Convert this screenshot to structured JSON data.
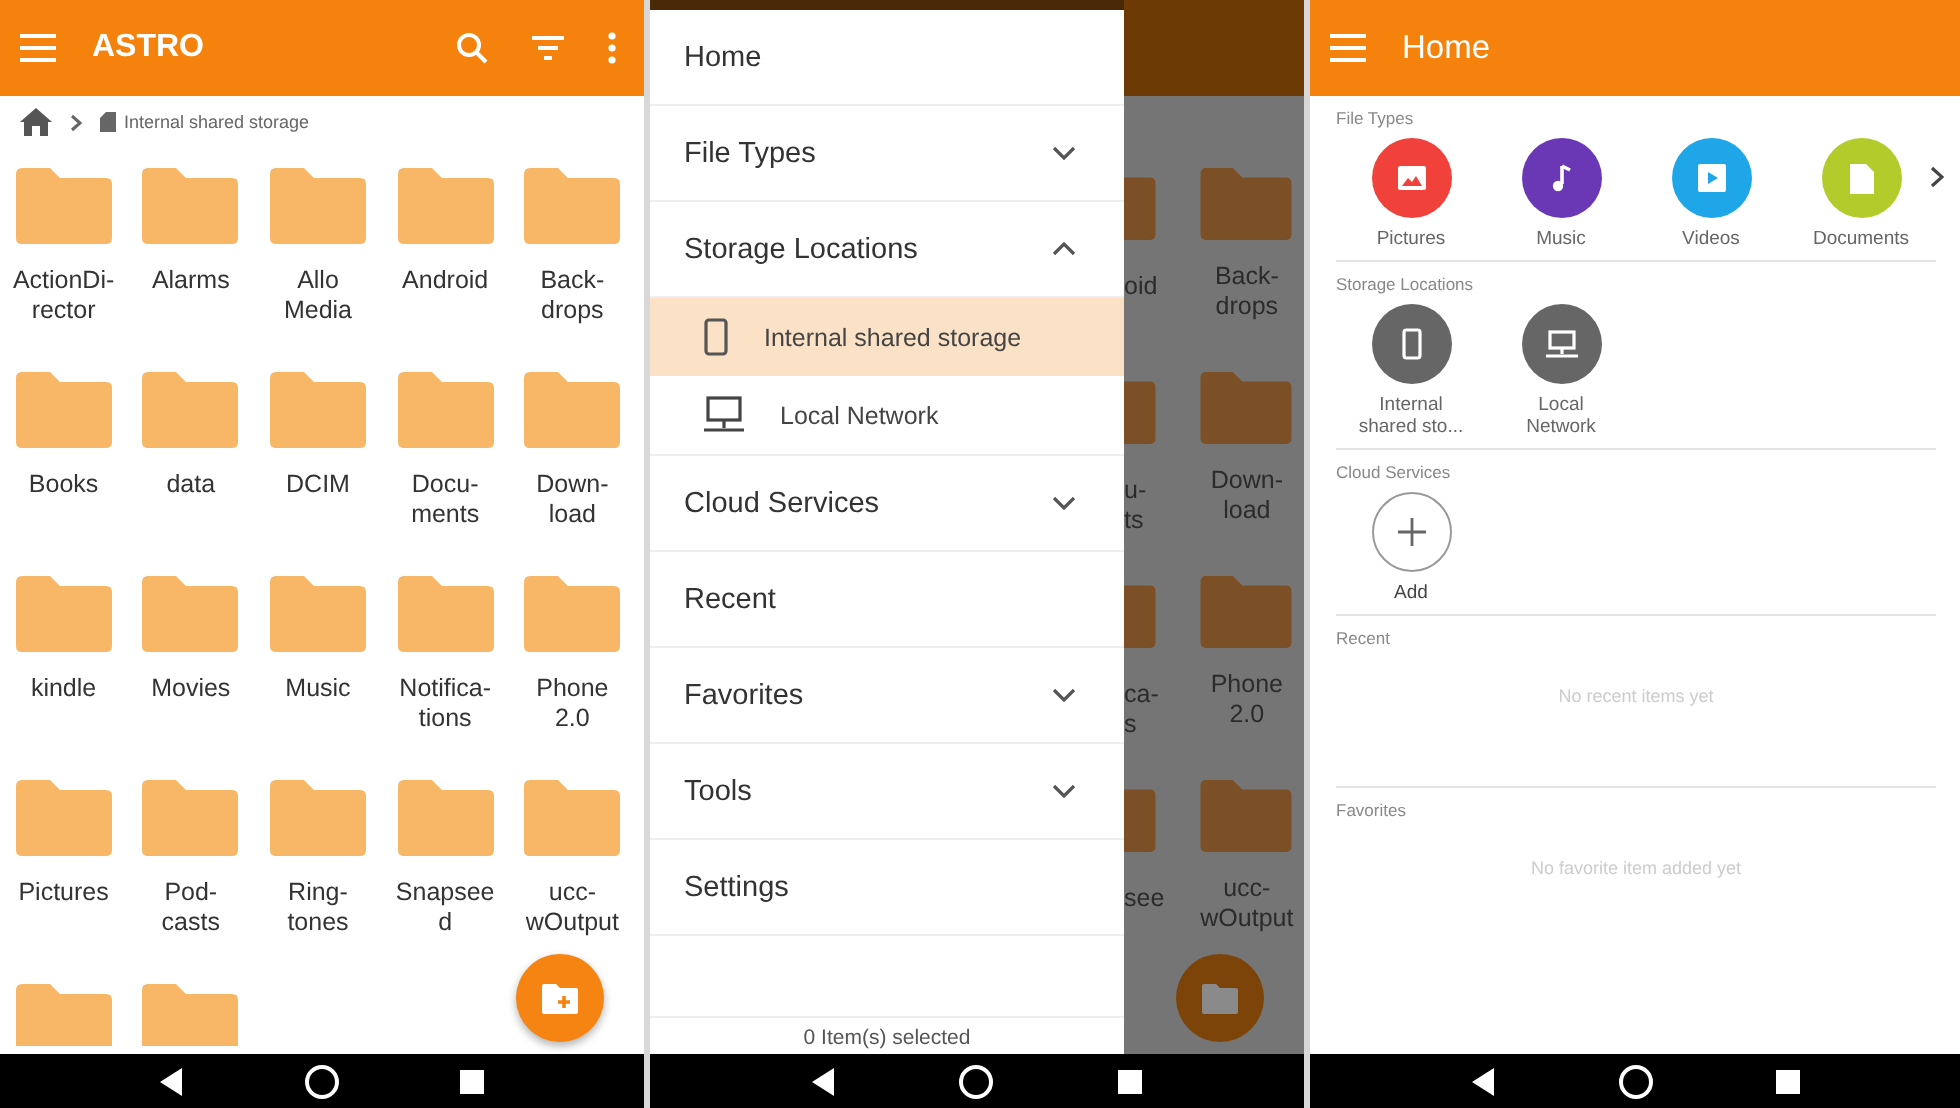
{
  "browser_screen": {
    "title": "ASTRO",
    "breadcrumb": "Internal shared storage",
    "folders": [
      {
        "label": "ActionDi-\nrector",
        "cut_off": false
      },
      {
        "label": "Alarms",
        "cut_off": false
      },
      {
        "label": "Allo\nMedia",
        "cut_off": false
      },
      {
        "label": "Android",
        "cut_off": false
      },
      {
        "label": "Back-\ndrops",
        "cut_off": false
      },
      {
        "label": "Books",
        "cut_off": false
      },
      {
        "label": "data",
        "cut_off": false
      },
      {
        "label": "DCIM",
        "cut_off": false
      },
      {
        "label": "Docu-\nments",
        "cut_off": false
      },
      {
        "label": "Down-\nload",
        "cut_off": false
      },
      {
        "label": "kindle",
        "cut_off": false
      },
      {
        "label": "Movies",
        "cut_off": false
      },
      {
        "label": "Music",
        "cut_off": false
      },
      {
        "label": "Notifica-\ntions",
        "cut_off": false
      },
      {
        "label": "Phone\n2.0",
        "cut_off": false
      },
      {
        "label": "Pictures",
        "cut_off": false
      },
      {
        "label": "Pod-\ncasts",
        "cut_off": false
      },
      {
        "label": "Ring-\ntones",
        "cut_off": false
      },
      {
        "label": "Snapsee\nd",
        "cut_off": false
      },
      {
        "label": "ucc-\nwOutput",
        "cut_off": false
      },
      {
        "cut_off": true
      },
      {
        "cut_off": true
      }
    ]
  },
  "drawer_screen": {
    "items": [
      {
        "kind": "link",
        "label": "Home"
      },
      {
        "kind": "group",
        "label": "File Types",
        "expanded": false
      },
      {
        "kind": "group",
        "label": "Storage Locations",
        "expanded": true,
        "children": [
          {
            "label": "Internal shared storage",
            "selected": true
          },
          {
            "label": "Local Network",
            "selected": false
          }
        ]
      },
      {
        "kind": "group",
        "label": "Cloud Services",
        "expanded": false
      },
      {
        "kind": "link",
        "label": "Recent"
      },
      {
        "kind": "group",
        "label": "Favorites",
        "expanded": false
      },
      {
        "kind": "group",
        "label": "Tools",
        "expanded": false
      },
      {
        "kind": "link",
        "label": "Settings"
      }
    ],
    "footer": "0 Item(s) selected",
    "behind_rows": [
      {
        "clipped": "oid",
        "full": "Back-\ndrops"
      },
      {
        "clipped": "u-\nts",
        "full": "Down-\nload"
      },
      {
        "clipped": "ca-\ns",
        "full": "Phone\n2.0"
      },
      {
        "clipped": "see",
        "full": "ucc-\nwOutput"
      }
    ]
  },
  "home_screen": {
    "title": "Home",
    "sections": [
      {
        "kind": "tiles",
        "title": "File Types",
        "tiles": [
          {
            "label": "Pictures",
            "color": "#f0413a"
          },
          {
            "label": "Music",
            "color": "#6a38b4"
          },
          {
            "label": "Videos",
            "color": "#1ea6e8"
          },
          {
            "label": "Documents",
            "color": "#b3cc2c"
          }
        ]
      },
      {
        "kind": "tiles",
        "title": "Storage Locations",
        "tiles": [
          {
            "label": "Internal\nshared sto...",
            "color": "#666666"
          },
          {
            "label": "Local\nNetwork",
            "color": "#666666"
          }
        ]
      },
      {
        "kind": "add",
        "title": "Cloud Services",
        "label": "Add"
      },
      {
        "kind": "empty",
        "title": "Recent",
        "message": "No recent items yet"
      },
      {
        "kind": "empty",
        "title": "Favorites",
        "message": "No favorite item added yet"
      }
    ]
  }
}
